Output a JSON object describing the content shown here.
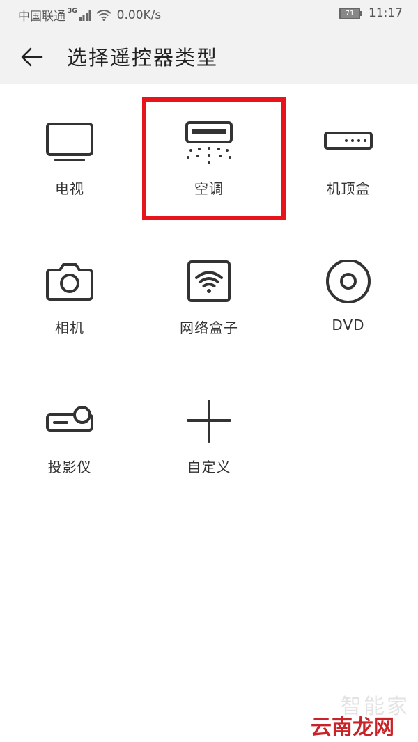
{
  "status_bar": {
    "carrier": "中国联通",
    "network": "3G",
    "speed": "0.00K/s",
    "battery": "71",
    "time": "11:17"
  },
  "header": {
    "title": "选择遥控器类型"
  },
  "devices": [
    {
      "label": "电视",
      "icon": "tv-icon"
    },
    {
      "label": "空调",
      "icon": "air-conditioner-icon",
      "highlighted": true
    },
    {
      "label": "机顶盒",
      "icon": "set-top-box-icon"
    },
    {
      "label": "相机",
      "icon": "camera-icon"
    },
    {
      "label": "网络盒子",
      "icon": "network-box-icon"
    },
    {
      "label": "DVD",
      "icon": "disc-icon"
    },
    {
      "label": "投影仪",
      "icon": "projector-icon"
    },
    {
      "label": "自定义",
      "icon": "plus-icon"
    }
  ],
  "colors": {
    "highlight": "#e8141b",
    "icon_stroke": "#333333"
  },
  "watermark": {
    "line1": "智能家",
    "line2": "云南龙网"
  }
}
